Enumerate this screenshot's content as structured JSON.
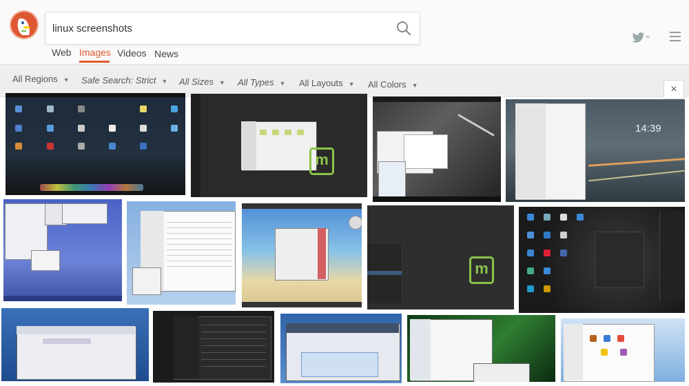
{
  "search": {
    "query": "linux screenshots"
  },
  "tabs": [
    {
      "label": "Web",
      "active": false
    },
    {
      "label": "Images",
      "active": true
    },
    {
      "label": "Videos",
      "active": false
    },
    {
      "label": "News",
      "active": false
    }
  ],
  "filters": [
    {
      "label": "All Regions"
    },
    {
      "label": "Safe Search: Strict"
    },
    {
      "label": "All Sizes"
    },
    {
      "label": "All Types"
    },
    {
      "label": "All Layouts"
    },
    {
      "label": "All Colors"
    }
  ],
  "close": {
    "label": "×"
  },
  "icons": {
    "logo": "duckduckgo-logo",
    "search": "search-icon",
    "twitter": "twitter-icon",
    "menu": "hamburger-menu-icon",
    "dropdown": "chevron-down-icon"
  },
  "colors": {
    "accent": "#de5833",
    "filter_bar": "#eeeeee"
  },
  "results": {
    "rows": [
      {
        "count": 4
      },
      {
        "count": 5
      },
      {
        "count": 5
      }
    ]
  }
}
